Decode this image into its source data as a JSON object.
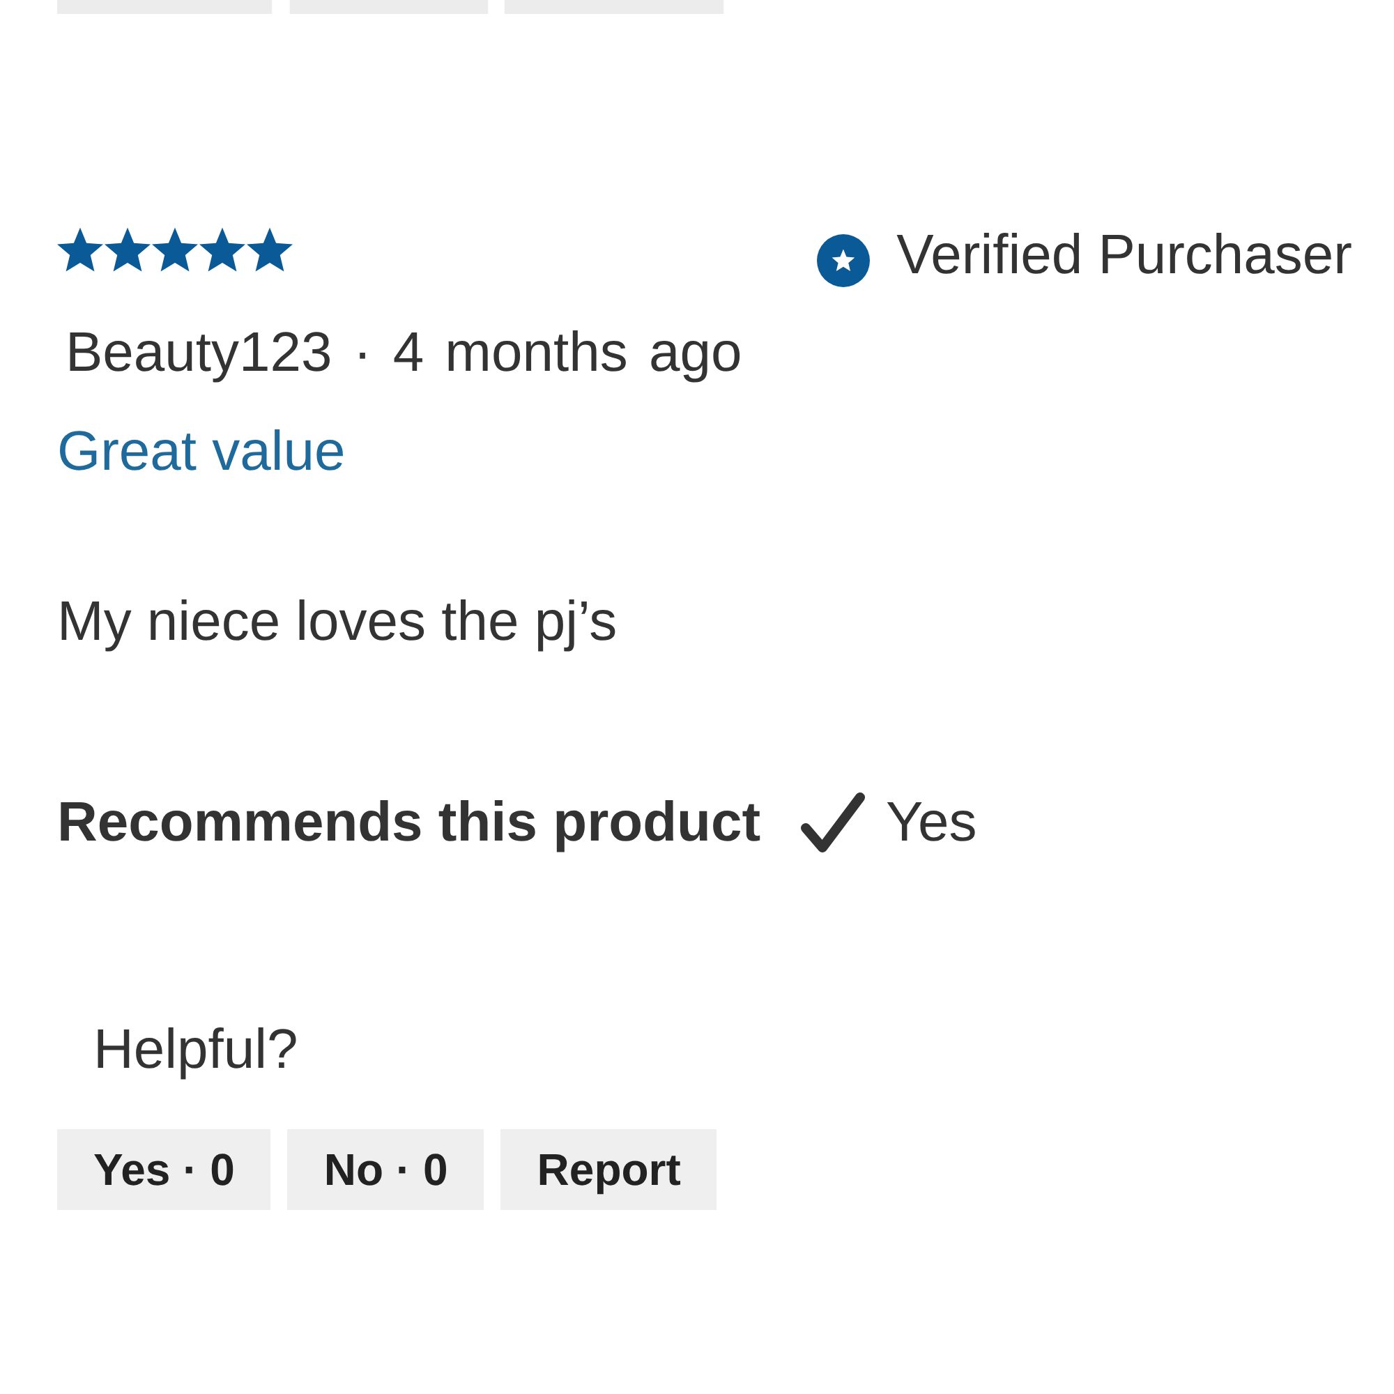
{
  "previous_review": {
    "buttons": [
      {
        "kind": "yes"
      },
      {
        "kind": "no"
      },
      {
        "kind": "report"
      }
    ]
  },
  "review": {
    "stars": 5,
    "verified_label": "Verified Purchaser",
    "byline": "Beauty123 · 4 months ago",
    "title": "Great value",
    "body": "My niece loves the pj’s",
    "recommendation": {
      "label": "Recommends this product",
      "recommended": true,
      "answer": "Yes"
    },
    "helpful_prompt": "Helpful?",
    "buttons": [
      {
        "label": "Yes · 0"
      },
      {
        "label": "No · 0"
      },
      {
        "label": "Report"
      }
    ]
  }
}
